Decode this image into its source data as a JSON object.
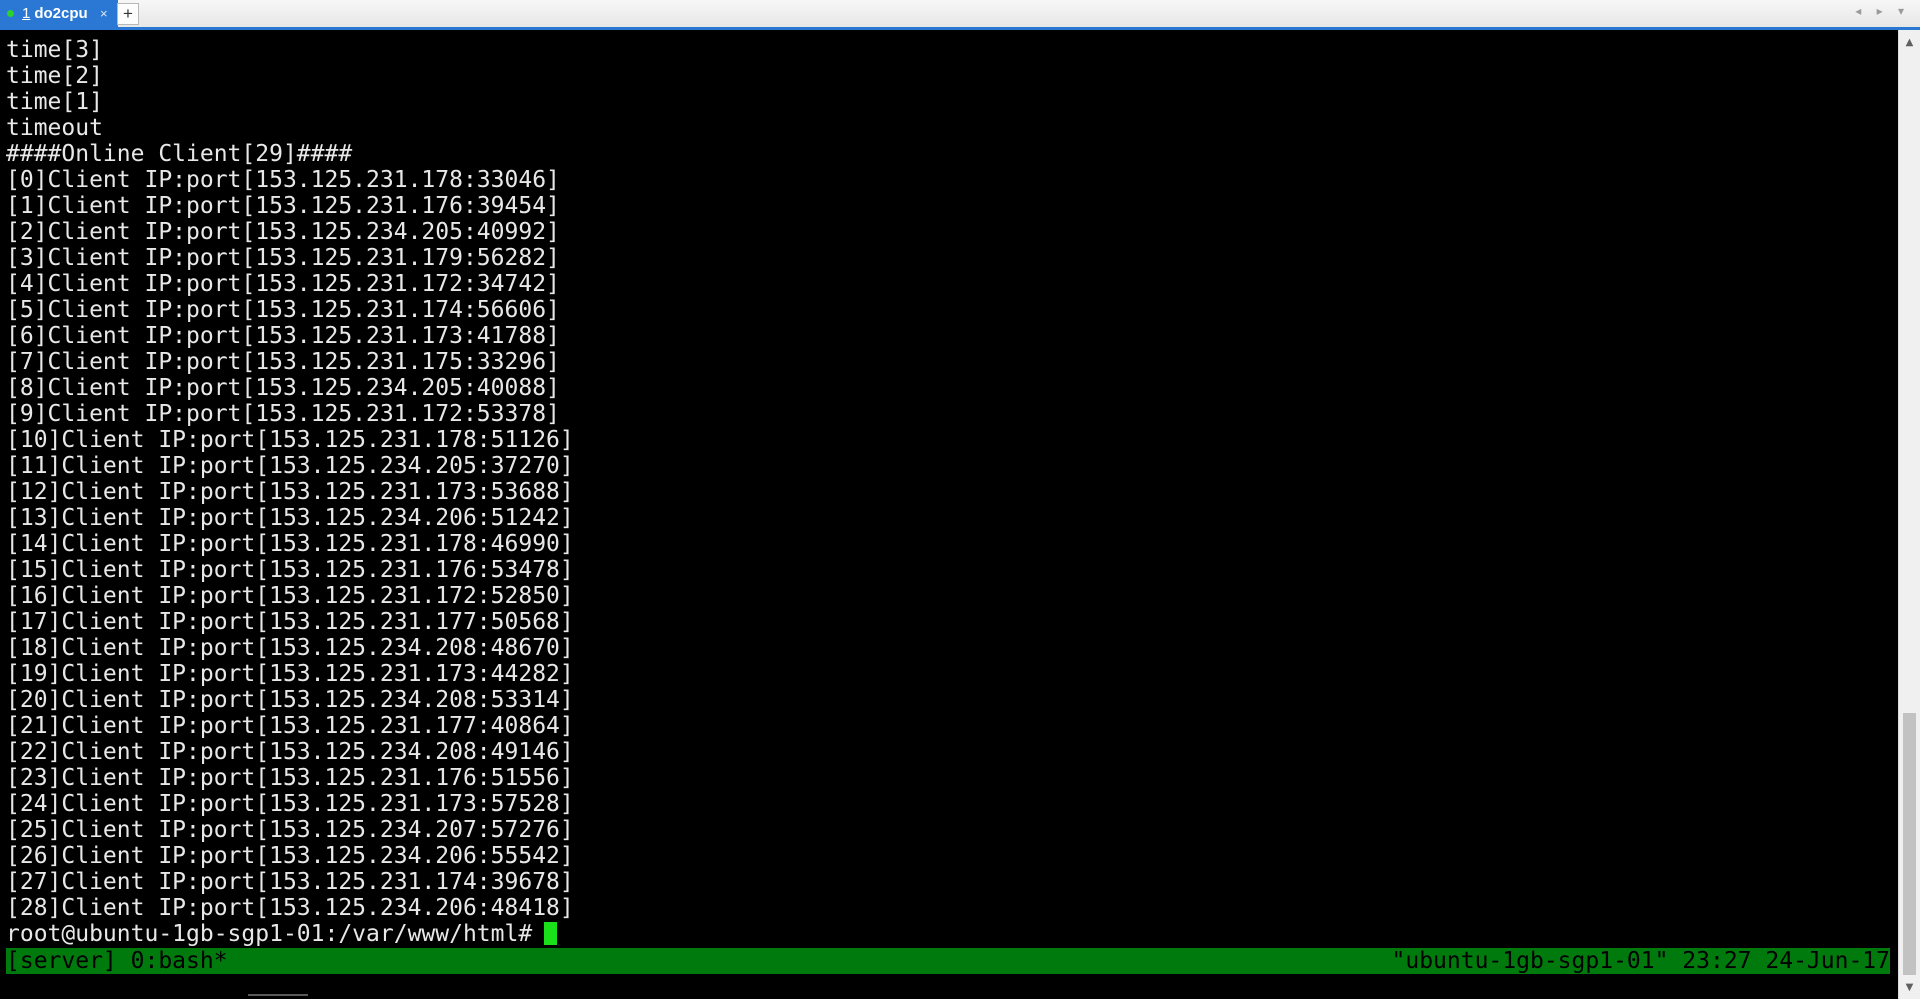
{
  "tabbar": {
    "tab_number": "1",
    "tab_title": "do2cpu",
    "close_glyph": "×",
    "new_tab_glyph": "+",
    "nav_arrows": "◂ ▸ ▾"
  },
  "terminal": {
    "lines": [
      "time[3]",
      "time[2]",
      "time[1]",
      "timeout",
      "####Online Client[29]####",
      "[0]Client IP:port[153.125.231.178:33046]",
      "[1]Client IP:port[153.125.231.176:39454]",
      "[2]Client IP:port[153.125.234.205:40992]",
      "[3]Client IP:port[153.125.231.179:56282]",
      "[4]Client IP:port[153.125.231.172:34742]",
      "[5]Client IP:port[153.125.231.174:56606]",
      "[6]Client IP:port[153.125.231.173:41788]",
      "[7]Client IP:port[153.125.231.175:33296]",
      "[8]Client IP:port[153.125.234.205:40088]",
      "[9]Client IP:port[153.125.231.172:53378]",
      "[10]Client IP:port[153.125.231.178:51126]",
      "[11]Client IP:port[153.125.234.205:37270]",
      "[12]Client IP:port[153.125.231.173:53688]",
      "[13]Client IP:port[153.125.234.206:51242]",
      "[14]Client IP:port[153.125.231.178:46990]",
      "[15]Client IP:port[153.125.231.176:53478]",
      "[16]Client IP:port[153.125.231.172:52850]",
      "[17]Client IP:port[153.125.231.177:50568]",
      "[18]Client IP:port[153.125.234.208:48670]",
      "[19]Client IP:port[153.125.231.173:44282]",
      "[20]Client IP:port[153.125.234.208:53314]",
      "[21]Client IP:port[153.125.231.177:40864]",
      "[22]Client IP:port[153.125.234.208:49146]",
      "[23]Client IP:port[153.125.231.176:51556]",
      "[24]Client IP:port[153.125.231.173:57528]",
      "[25]Client IP:port[153.125.234.207:57276]",
      "[26]Client IP:port[153.125.234.206:55542]",
      "[27]Client IP:port[153.125.231.174:39678]",
      "[28]Client IP:port[153.125.234.206:48418]"
    ],
    "prompt": "root@ubuntu-1gb-sgp1-01:/var/www/html#"
  },
  "statusbar": {
    "left": "[server] 0:bash*",
    "right": "\"ubuntu-1gb-sgp1-01\" 23:27 24-Jun-17"
  },
  "scrollbar": {
    "up_glyph": "▲",
    "down_glyph": "▼",
    "position_fraction": 0.74
  },
  "colors": {
    "tab_active": "#2a78d4",
    "terminal_bg": "#000000",
    "terminal_fg": "#e8e8e8",
    "status_bg": "#007a0c",
    "cursor": "#19e019"
  }
}
